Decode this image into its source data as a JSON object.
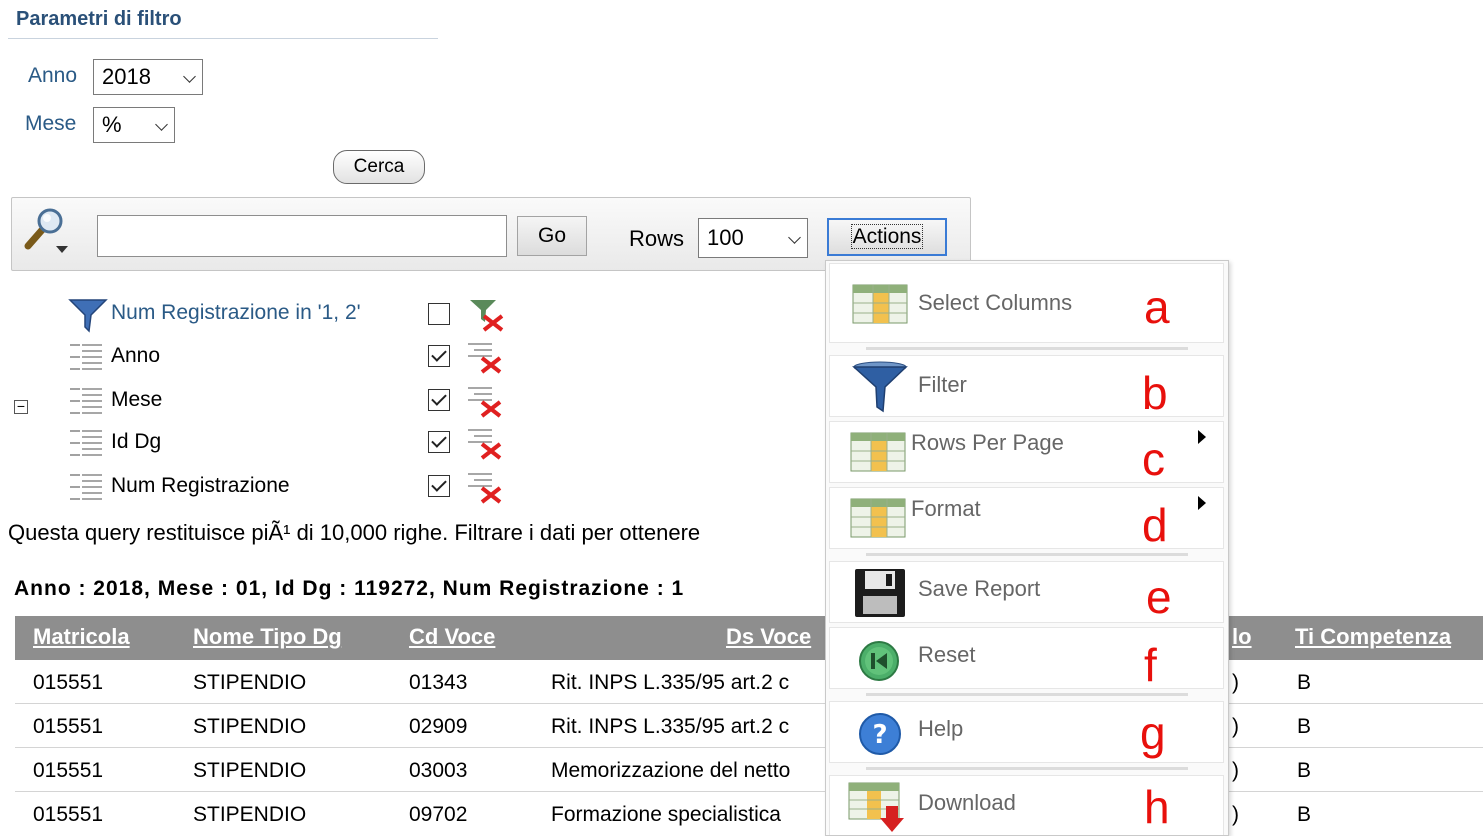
{
  "params": {
    "title": "Parametri di filtro",
    "anno_label": "Anno",
    "anno_value": "2018",
    "mese_label": "Mese",
    "mese_value": "%",
    "search_button": "Cerca"
  },
  "toolbar": {
    "search_value": "",
    "go_label": "Go",
    "rows_label": "Rows",
    "rows_value": "100",
    "actions_label": "Actions"
  },
  "filters": [
    {
      "label": "Num Registrazione in '1, 2'",
      "checked": false,
      "icon": "funnel-icon"
    },
    {
      "label": "Anno",
      "checked": true,
      "icon": "control-break-icon"
    },
    {
      "label": "Mese",
      "checked": true,
      "icon": "control-break-icon"
    },
    {
      "label": "Id Dg",
      "checked": true,
      "icon": "control-break-icon"
    },
    {
      "label": "Num Registrazione",
      "checked": true,
      "icon": "control-break-icon"
    }
  ],
  "message": "Questa query restituisce piÃ¹ di 10,000 righe. Filtrare i dati per ottenere",
  "break_header": "Anno : 2018, Mese : 01, Id Dg : 119272, Num Registrazione : 1",
  "table": {
    "columns": [
      "Matricola",
      "Nome Tipo Dg",
      "Cd Voce",
      "Ds Voce",
      "lo",
      "Ti Competenza"
    ],
    "rows": [
      [
        "015551",
        "STIPENDIO",
        "01343",
        "Rit. INPS L.335/95 art.2 c",
        ")",
        "B"
      ],
      [
        "015551",
        "STIPENDIO",
        "02909",
        "Rit. INPS L.335/95 art.2 c",
        ")",
        "B"
      ],
      [
        "015551",
        "STIPENDIO",
        "03003",
        "Memorizzazione del netto",
        ")",
        "B"
      ],
      [
        "015551",
        "STIPENDIO",
        "09702",
        "Formazione specialistica",
        ")",
        "B"
      ]
    ]
  },
  "menu": {
    "items": [
      {
        "label": "Select Columns",
        "letter": "a",
        "icon": "select-columns-icon"
      },
      {
        "label": "Filter",
        "letter": "b",
        "icon": "filter-icon"
      },
      {
        "label": "Rows Per Page",
        "letter": "c",
        "icon": "rows-per-page-icon"
      },
      {
        "label": "Format",
        "letter": "d",
        "icon": "format-icon"
      },
      {
        "label": "Save Report",
        "letter": "e",
        "icon": "floppy-disk-icon"
      },
      {
        "label": "Reset",
        "letter": "f",
        "icon": "reset-icon"
      },
      {
        "label": "Help",
        "letter": "g",
        "icon": "help-icon"
      },
      {
        "label": "Download",
        "letter": "h",
        "icon": "download-icon"
      }
    ]
  },
  "colors": {
    "accent": "#2a5a86",
    "header_bg": "#8e8e8e",
    "annotation": "#e8100c",
    "actions_border": "#3a7bd5"
  }
}
